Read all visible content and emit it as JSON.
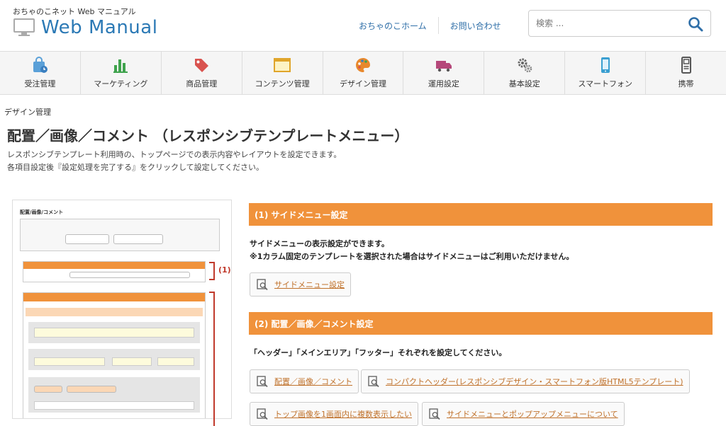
{
  "header": {
    "site_subtitle": "おちゃのこネット Web マニュアル",
    "logo_text": "Web Manual",
    "links": [
      "おちゃのこホーム",
      "お問い合わせ"
    ],
    "search_placeholder": "検索 ..."
  },
  "nav": {
    "items": [
      {
        "label": "受注管理",
        "icon": "shopping-bag-icon"
      },
      {
        "label": "マーケティング",
        "icon": "bar-chart-icon"
      },
      {
        "label": "商品管理",
        "icon": "tag-icon"
      },
      {
        "label": "コンテンツ管理",
        "icon": "window-icon"
      },
      {
        "label": "デザイン管理",
        "icon": "palette-icon"
      },
      {
        "label": "運用設定",
        "icon": "truck-icon"
      },
      {
        "label": "基本設定",
        "icon": "gears-icon"
      },
      {
        "label": "スマートフォン",
        "icon": "smartphone-icon"
      },
      {
        "label": "携帯",
        "icon": "mobile-phone-icon"
      }
    ]
  },
  "content": {
    "breadcrumb": "デザイン管理",
    "title": "配置／画像／コメント （レスポンシブテンプレートメニュー）",
    "description": [
      "レスポンシブテンプレート利用時の、トップページでの表示内容やレイアウトを設定できます。",
      "各項目設定後『設定処理を完了する』をクリックして設定してください。"
    ]
  },
  "thumbnail": {
    "title": "配置/画像/コメント",
    "bracket_1": "(1)"
  },
  "sections": [
    {
      "heading": "(1) サイドメニュー設定",
      "text": [
        "サイドメニューの表示設定ができます。",
        "※1カラム固定のテンプレートを選択された場合はサイドメニューはご利用いただけません。"
      ],
      "links": [
        "サイドメニュー設定"
      ]
    },
    {
      "heading": "(2) 配置／画像／コメント設定",
      "text": [
        "「ヘッダー」「メインエリア」「フッター」それぞれを設定してください。"
      ],
      "links": [
        "配置／画像／コメント",
        "コンパクトヘッダー(レスポンシブデザイン・スマートフォン版HTML5テンプレート)",
        "トップ画像を1画面内に複数表示したい",
        "サイドメニューとポップアップメニューについて"
      ]
    }
  ],
  "colors": {
    "accent": "#f0923b",
    "link": "#c0712a",
    "logo": "#2b79b5",
    "header_link": "#2f6fa8"
  }
}
